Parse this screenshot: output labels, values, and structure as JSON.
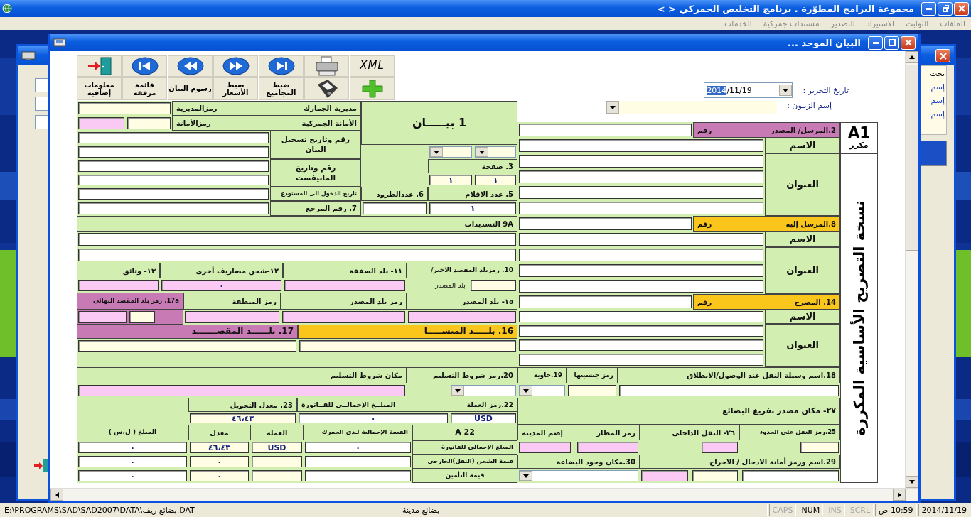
{
  "window": {
    "title": "مجموعة البرامج المطوّرة . برنامج التخليص الجمركي < >"
  },
  "menu": [
    "الملفات",
    "الثوابت",
    "الاستيراد",
    "التصدير",
    "مستندات جمركية",
    "الخدمات"
  ],
  "back_window": {
    "side_labels": [
      "بحث",
      "إسم",
      "إسم",
      "إسم"
    ]
  },
  "dialog": {
    "title": "البيان الموحد ...",
    "toolbar": {
      "xml": "XML",
      "labels": [
        "ضبط المجاميع",
        "ضبط الأسعار",
        "رسوم البيان",
        "قائمة مرفقة",
        "معلومات إضافية"
      ]
    },
    "date": {
      "label": "تاريخ التحرير :",
      "selected_part": "2014",
      "rest": "/11/19"
    },
    "customer": {
      "label": "إسم الزبـون :"
    },
    "side_band": {
      "code": "A1",
      "note": "مكرر",
      "title": "نسخة التصريح الأساسية المكررة"
    },
    "cells": [
      {
        "kind": "label",
        "text": "1 بيـــــان"
      },
      {
        "kind": "label",
        "parts": [
          "مديرية الجمارك",
          "رمزالمديرية"
        ]
      },
      {
        "kind": "field-cream"
      },
      {
        "kind": "label",
        "parts": [
          "الأمانة الجمركية",
          "رمزالأمانة"
        ]
      },
      {
        "kind": "field-cream"
      },
      {
        "kind": "field-pink"
      },
      {
        "kind": "label",
        "text": "رقم وتاريخ تسجيل البيان"
      },
      {
        "kind": "field"
      },
      {
        "kind": "field"
      },
      {
        "kind": "dropdown-cream"
      },
      {
        "kind": "dropdown-cream"
      },
      {
        "kind": "label",
        "text": "3. صفحة"
      },
      {
        "kind": "field-cream",
        "value": "١"
      },
      {
        "kind": "field-cream",
        "value": "١"
      },
      {
        "kind": "label",
        "text": "رقم وتاريخ المانيفست"
      },
      {
        "kind": "field"
      },
      {
        "kind": "field"
      },
      {
        "kind": "label",
        "text": "5. عدد الاقلام"
      },
      {
        "kind": "label",
        "text": "6. عددالطرود"
      },
      {
        "kind": "label",
        "text": "تاريخ الدخول الى المستودع"
      },
      {
        "kind": "field"
      },
      {
        "kind": "field",
        "value": "١"
      },
      {
        "kind": "field"
      },
      {
        "kind": "label",
        "text": "7. رقم المرجع"
      },
      {
        "kind": "field"
      },
      {
        "kind": "label",
        "text": "9A التسديدات"
      },
      {
        "kind": "field"
      },
      {
        "kind": "field"
      },
      {
        "kind": "label",
        "text": "10. رمزبلد المقصد الاخير/"
      },
      {
        "kind": "label-plain",
        "text": "بلد المصدر"
      },
      {
        "kind": "field-cream"
      },
      {
        "kind": "label",
        "text": "١١- بلد الصفقة"
      },
      {
        "kind": "field-pink"
      },
      {
        "kind": "label",
        "text": "١٢-شحن مصاريف أخرى"
      },
      {
        "kind": "field-pink",
        "value": "٠"
      },
      {
        "kind": "label",
        "text": "١٣- وثائق"
      },
      {
        "kind": "field-pink"
      },
      {
        "kind": "label",
        "text": "١٥- بلد المصدر"
      },
      {
        "kind": "field-pink"
      },
      {
        "kind": "label",
        "text": "رمز بلد المصدر"
      },
      {
        "kind": "field-pink"
      },
      {
        "kind": "label",
        "text": "رمز المنطقة"
      },
      {
        "kind": "field-pink"
      },
      {
        "kind": "label-purple",
        "text": "17a. رمز بلد المقصد النهائي"
      },
      {
        "kind": "field-cream"
      },
      {
        "kind": "field-pink"
      },
      {
        "kind": "label-orange",
        "text": "16. بلـــــد المنشـــــا"
      },
      {
        "kind": "field-cream"
      },
      {
        "kind": "label-purple",
        "text": "17. بلــــــد المقصـــــــد"
      },
      {
        "kind": "field-cream"
      },
      {
        "kind": "label-purple",
        "parts": [
          "2.المرسل/ المصدر",
          "رقم"
        ]
      },
      {
        "kind": "field"
      },
      {
        "kind": "label",
        "text": "الاسم"
      },
      {
        "kind": "field"
      },
      {
        "kind": "label",
        "text": "العنوان"
      },
      {
        "kind": "field"
      },
      {
        "kind": "field"
      },
      {
        "kind": "field"
      },
      {
        "kind": "field"
      },
      {
        "kind": "label-orange",
        "parts": [
          "8.المرسل إليه",
          "رقم"
        ]
      },
      {
        "kind": "field"
      },
      {
        "kind": "label",
        "text": "الاسم"
      },
      {
        "kind": "field"
      },
      {
        "kind": "label",
        "text": "العنوان"
      },
      {
        "kind": "field"
      },
      {
        "kind": "field"
      },
      {
        "kind": "field"
      },
      {
        "kind": "label-orange",
        "parts": [
          "14. المصرح",
          "رقم"
        ]
      },
      {
        "kind": "field"
      },
      {
        "kind": "label",
        "text": "الاسم"
      },
      {
        "kind": "field"
      },
      {
        "kind": "label",
        "text": "العنوان"
      },
      {
        "kind": "field"
      },
      {
        "kind": "field"
      },
      {
        "kind": "field"
      },
      {
        "kind": "label",
        "text": "18.اسم وسيلة النقل عند الوصول/الانطلاق"
      },
      {
        "kind": "label",
        "text": "رمز جنسيتها"
      },
      {
        "kind": "label",
        "text": "19.حاوية"
      },
      {
        "kind": "label",
        "text": "20.رمز شروط التسليم"
      },
      {
        "kind": "label",
        "text": "مكان شروط التسليم"
      },
      {
        "kind": "field"
      },
      {
        "kind": "field-cream"
      },
      {
        "kind": "dropdown"
      },
      {
        "kind": "dropdown"
      },
      {
        "kind": "field-pink"
      },
      {
        "kind": "label",
        "text": "٢٧- مكان مصدر تفريغ البضائع"
      },
      {
        "kind": "label",
        "parts": [
          "22.رمز العملة",
          "المبلــغ الإجمالــي للفــاتورة"
        ]
      },
      {
        "kind": "label",
        "text": "23. معدل التحويل"
      },
      {
        "kind": "field",
        "value": "USD"
      },
      {
        "kind": "field",
        "value": "٠"
      },
      {
        "kind": "field-cream",
        "value": "٤٦،٤٣"
      },
      {
        "kind": "label",
        "text": "25.رمز النقل على الحدود"
      },
      {
        "kind": "label",
        "text": "٢٦- النقل الداخلي"
      },
      {
        "kind": "label",
        "parts": [
          "رمز المطار",
          "إصم المدينة"
        ]
      },
      {
        "kind": "label",
        "text": "22 A"
      },
      {
        "kind": "label",
        "text": "القيمة الإجمالية لـدى الجمرك"
      },
      {
        "kind": "label",
        "text": "العملة"
      },
      {
        "kind": "label",
        "text": "معدل"
      },
      {
        "kind": "label",
        "text": "المبلغ ( ل.س )"
      },
      {
        "kind": "field-cream"
      },
      {
        "kind": "field-pink"
      },
      {
        "kind": "field-pink"
      },
      {
        "kind": "field-pink"
      },
      {
        "kind": "label",
        "text": "المبلغ الإجمالي للفاتورة"
      },
      {
        "kind": "field",
        "value": "٠"
      },
      {
        "kind": "field-cream",
        "value": "USD"
      },
      {
        "kind": "field-cream",
        "value": "٤٦،٤٣"
      },
      {
        "kind": "field",
        "value": "٠"
      },
      {
        "kind": "label",
        "text": "29.اسم ورمز أمانة الادخال / الاخراج"
      },
      {
        "kind": "label",
        "text": "30.مكان وجود البضاعة"
      },
      {
        "kind": "label",
        "text": "قيمة الشحن (النقل)الخارجي"
      },
      {
        "kind": "field"
      },
      {
        "kind": "field-cream"
      },
      {
        "kind": "field-cream",
        "value": "٠"
      },
      {
        "kind": "field",
        "value": "٠"
      },
      {
        "kind": "field"
      },
      {
        "kind": "field-cream"
      },
      {
        "kind": "field-pink"
      },
      {
        "kind": "dropdown"
      },
      {
        "kind": "label",
        "text": "قيمة التأمين"
      },
      {
        "kind": "field"
      },
      {
        "kind": "field-cream"
      },
      {
        "kind": "field-cream",
        "value": "٠"
      },
      {
        "kind": "field",
        "value": "٠"
      }
    ]
  },
  "status_bar": {
    "path": "E:\\PROGRAMS\\SAD\\SAD2007\\DATA\\بضائع ريف.DAT",
    "panels": [
      {
        "text": "2014/11/19"
      },
      {
        "text": "10:59 ص"
      },
      {
        "text": "SCRL",
        "on": false
      },
      {
        "text": "INS",
        "on": false
      },
      {
        "text": "NUM",
        "on": true
      },
      {
        "text": "CAPS",
        "on": false
      },
      {
        "text": "بضائع مدينة"
      }
    ]
  }
}
